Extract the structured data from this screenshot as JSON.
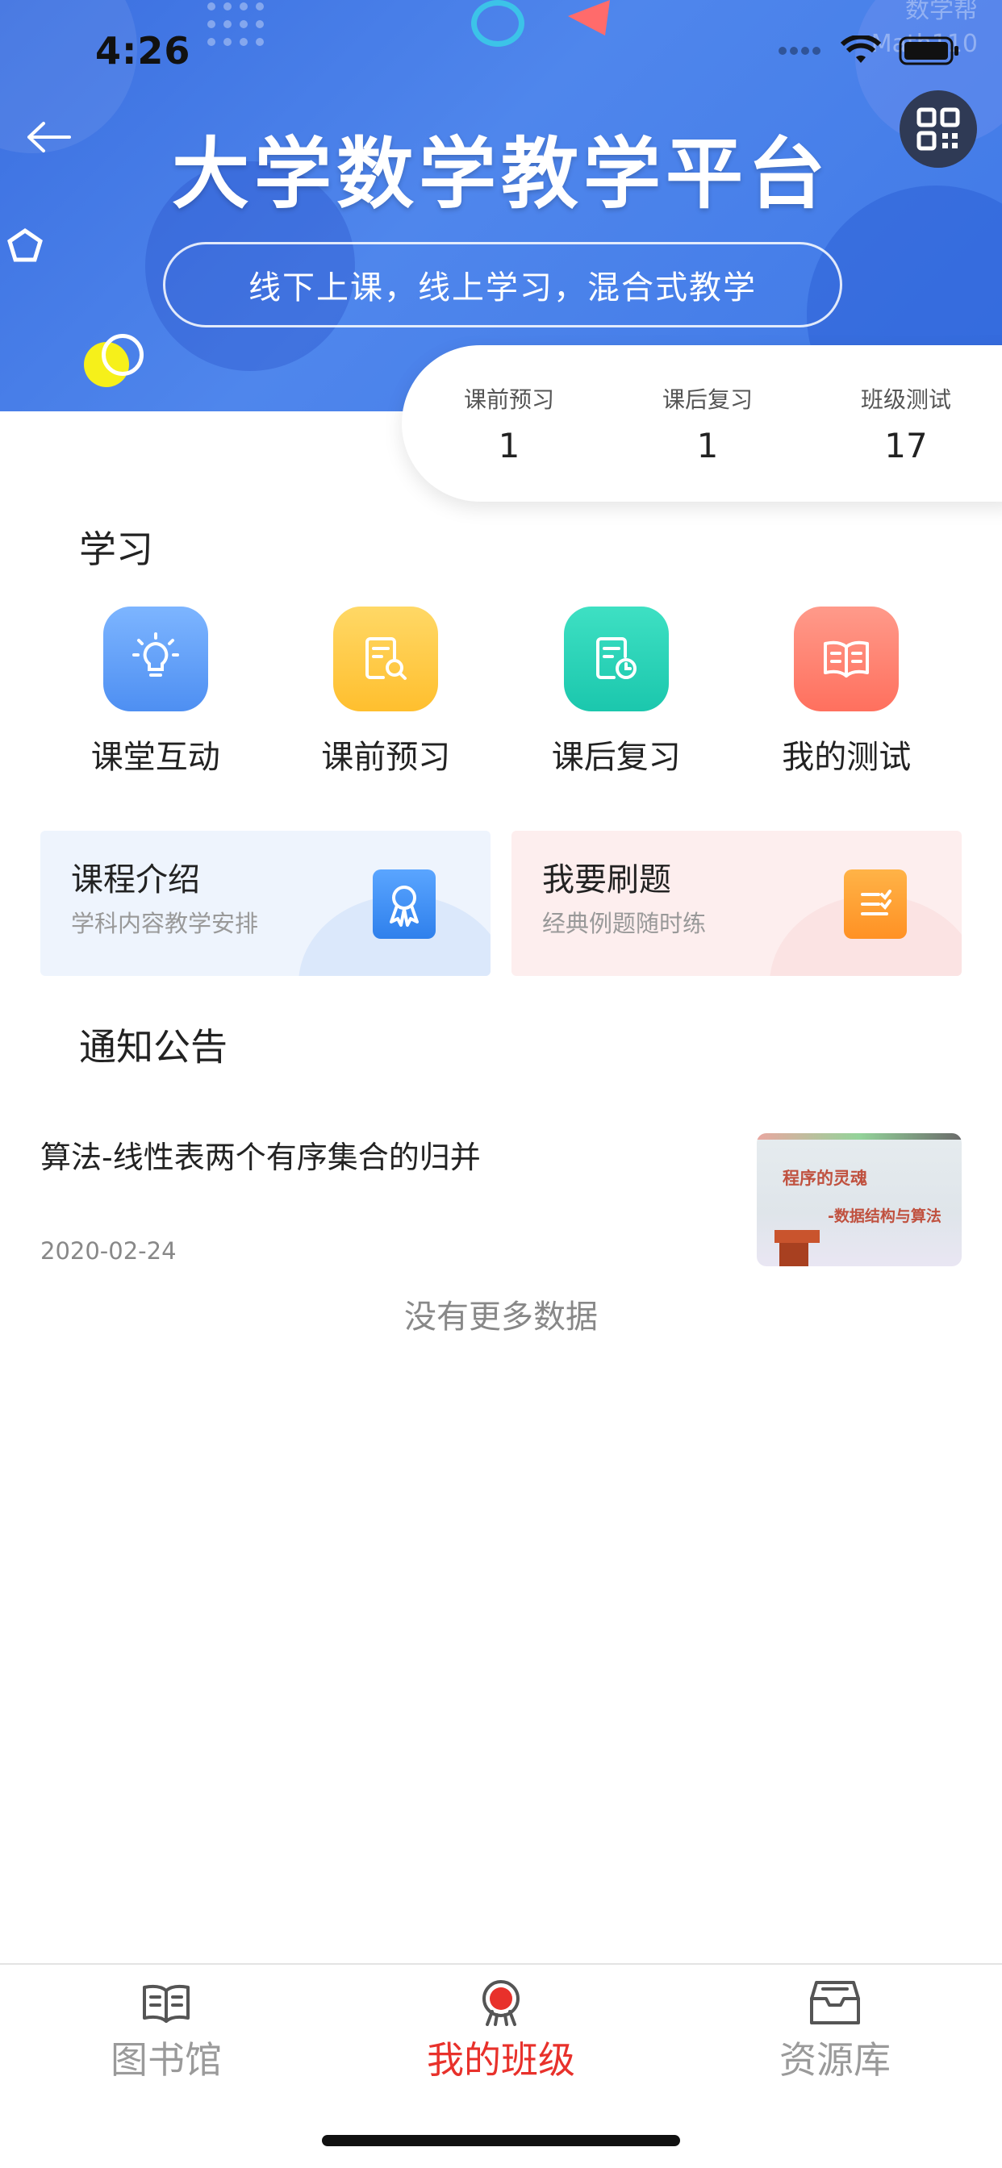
{
  "status_bar": {
    "time": "4:26"
  },
  "banner": {
    "title": "大学数学教学平台",
    "subtitle": "线下上课，线上学习，混合式教学",
    "watermark_line1": "数学帮",
    "watermark_line2": "Math110",
    "back_icon": "arrow-left-icon",
    "qr_icon": "qr-code-icon"
  },
  "stats": [
    {
      "label": "课前预习",
      "value": "1"
    },
    {
      "label": "课后复习",
      "value": "1"
    },
    {
      "label": "班级测试",
      "value": "17"
    }
  ],
  "study": {
    "title": "学习",
    "items": [
      {
        "label": "课堂互动",
        "icon": "lightbulb-icon",
        "color": "#5b9cf6"
      },
      {
        "label": "课前预习",
        "icon": "document-search-icon",
        "color": "#ffc53d"
      },
      {
        "label": "课后复习",
        "icon": "document-clock-icon",
        "color": "#2dd4bf"
      },
      {
        "label": "我的测试",
        "icon": "open-book-icon",
        "color": "#ff7f6e"
      }
    ]
  },
  "cards": [
    {
      "title": "课程介绍",
      "subtitle": "学科内容教学安排",
      "icon": "badge-ribbon-icon",
      "bg": "#eef4fd",
      "icon_color": "#3d8ef0"
    },
    {
      "title": "我要刷题",
      "subtitle": "经典例题随时练",
      "icon": "checklist-icon",
      "bg": "#fdeeee",
      "icon_color": "#ff9a2e"
    }
  ],
  "notices": {
    "title": "通知公告",
    "items": [
      {
        "title": "算法-线性表两个有序集合的归并",
        "date": "2020-02-24",
        "thumb_line1": "程序的灵魂",
        "thumb_line2": "-数据结构与算法"
      }
    ],
    "no_more": "没有更多数据"
  },
  "tabbar": {
    "tabs": [
      {
        "label": "图书馆",
        "icon": "book-icon",
        "active": false
      },
      {
        "label": "我的班级",
        "icon": "class-mascot-icon",
        "active": true
      },
      {
        "label": "资源库",
        "icon": "inbox-tray-icon",
        "active": false
      }
    ],
    "active_color": "#e8312b",
    "inactive_color": "#9a9a9a"
  }
}
